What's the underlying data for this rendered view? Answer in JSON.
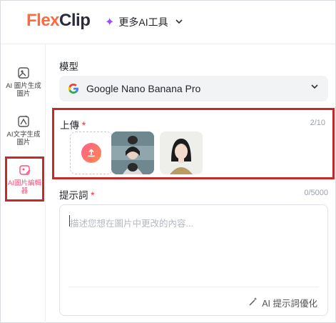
{
  "header": {
    "logo_flex": "Flex",
    "logo_clip": "Clip",
    "more_tools_label": "更多AI工具",
    "more_tools_icon": "sparkle-icon",
    "dropdown_icon": "chevron-down-icon"
  },
  "sidebar": {
    "items": [
      {
        "line1": "AI 圖片生成",
        "line2": "圖片",
        "icon": "image-generate-icon",
        "active": false
      },
      {
        "line1": "AI文字生成",
        "line2": "圖片",
        "icon": "text-to-image-icon",
        "active": false
      },
      {
        "line1": "AI圖片編輯",
        "line2": "器",
        "icon": "image-edit-icon",
        "active": true
      }
    ]
  },
  "main": {
    "model": {
      "label": "模型",
      "selected": "Google Nano Banana Pro",
      "provider_icon": "google-icon"
    },
    "upload": {
      "label": "上傳",
      "required_mark": "*",
      "count": "2/10",
      "upload_icon": "upload-icon"
    },
    "prompt": {
      "label": "提示詞",
      "required_mark": "*",
      "count": "0/5000",
      "placeholder": "描述您想在圖片中更改的內容...",
      "optimize_label": "AI 提示詞優化",
      "optimize_icon": "magic-wand-icon"
    }
  },
  "colors": {
    "accent_pink": "#ff4f7b",
    "highlight_red": "#c32b2b",
    "brand_orange": "#ff6a3d",
    "sparkle_purple": "#9b4dff"
  }
}
